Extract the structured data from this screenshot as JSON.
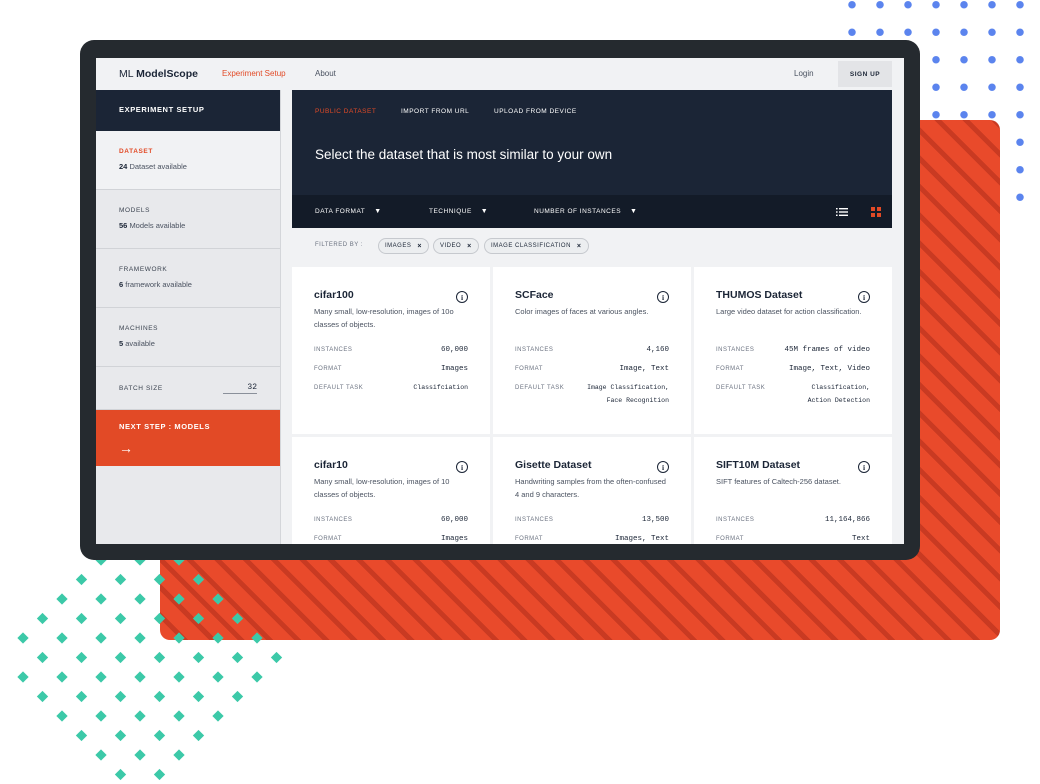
{
  "app": {
    "brand_prefix": "ML",
    "brand_name": "ModelScope"
  },
  "nav": {
    "experiment_setup": "Experiment Setup",
    "about": "About",
    "login": "Login",
    "signup": "SIGN UP"
  },
  "sidebar": {
    "header": "EXPERIMENT SETUP",
    "items": [
      {
        "label": "DATASET",
        "count": "24",
        "text": "Dataset available"
      },
      {
        "label": "MODELS",
        "count": "56",
        "text": "Models available"
      },
      {
        "label": "FRAMEWORK",
        "count": "6",
        "text": "framework available"
      },
      {
        "label": "MACHINES",
        "count": "5",
        "text": "available"
      }
    ],
    "batch_label": "BATCH SIZE",
    "batch_value": "32",
    "next_step": "NEXT STEP : MODELS",
    "next_arrow": "→"
  },
  "tabs": [
    "PUBLIC DATASET",
    "IMPORT FROM URL",
    "UPLOAD FROM DEVICE"
  ],
  "hero_title": "Select the dataset that is most similar to your own",
  "filters": [
    {
      "label": "DATA FORMAT",
      "caret": "▼"
    },
    {
      "label": "TECHNIQUE",
      "caret": "▼"
    },
    {
      "label": "NUMBER OF INSTANCES",
      "caret": "▼"
    }
  ],
  "filtered_by_label": "FILTERED BY :",
  "chips": [
    {
      "label": "IMAGES",
      "x": "×"
    },
    {
      "label": "VIDEO",
      "x": "×"
    },
    {
      "label": "IMAGE CLASSIFICATION",
      "x": "×"
    }
  ],
  "prop_labels": {
    "instances": "INSTANCES",
    "format": "FORMAT",
    "task": "DEFAULT TASK"
  },
  "info_glyph": "i",
  "cards": [
    {
      "title": "cifar100",
      "desc": "Many small, low-resolution, images of 10o classes of objects.",
      "instances": "60,000",
      "format": "Images",
      "task": "Classifciation"
    },
    {
      "title": "SCFace",
      "desc": "Color images of faces at various angles.",
      "instances": "4,160",
      "format": "Image, Text",
      "task": "Image Classification,\nFace Recognition"
    },
    {
      "title": "THUMOS Dataset",
      "desc": "Large video dataset for action classification.",
      "instances": "45M frames of video",
      "format": "Image, Text, Video",
      "task": "Classification,\nAction Detection"
    },
    {
      "title": "cifar10",
      "desc": "Many small, low-resolution, images of 10 classes of objects.",
      "instances": "60,000",
      "format": "Images",
      "task": ""
    },
    {
      "title": "Gisette Dataset",
      "desc": "Handwriting samples from the often-confused 4 and 9 characters.",
      "instances": "13,500",
      "format": "Images, Text",
      "task": ""
    },
    {
      "title": "SIFT10M Dataset",
      "desc": "SIFT features of Caltech-256 dataset.",
      "instances": "11,164,866",
      "format": "Text",
      "task": ""
    }
  ],
  "colors": {
    "accent": "#e24a26",
    "navy": "#1b2536",
    "blue_dots": "#5b84ee",
    "green_dots": "#3cc9a8"
  }
}
